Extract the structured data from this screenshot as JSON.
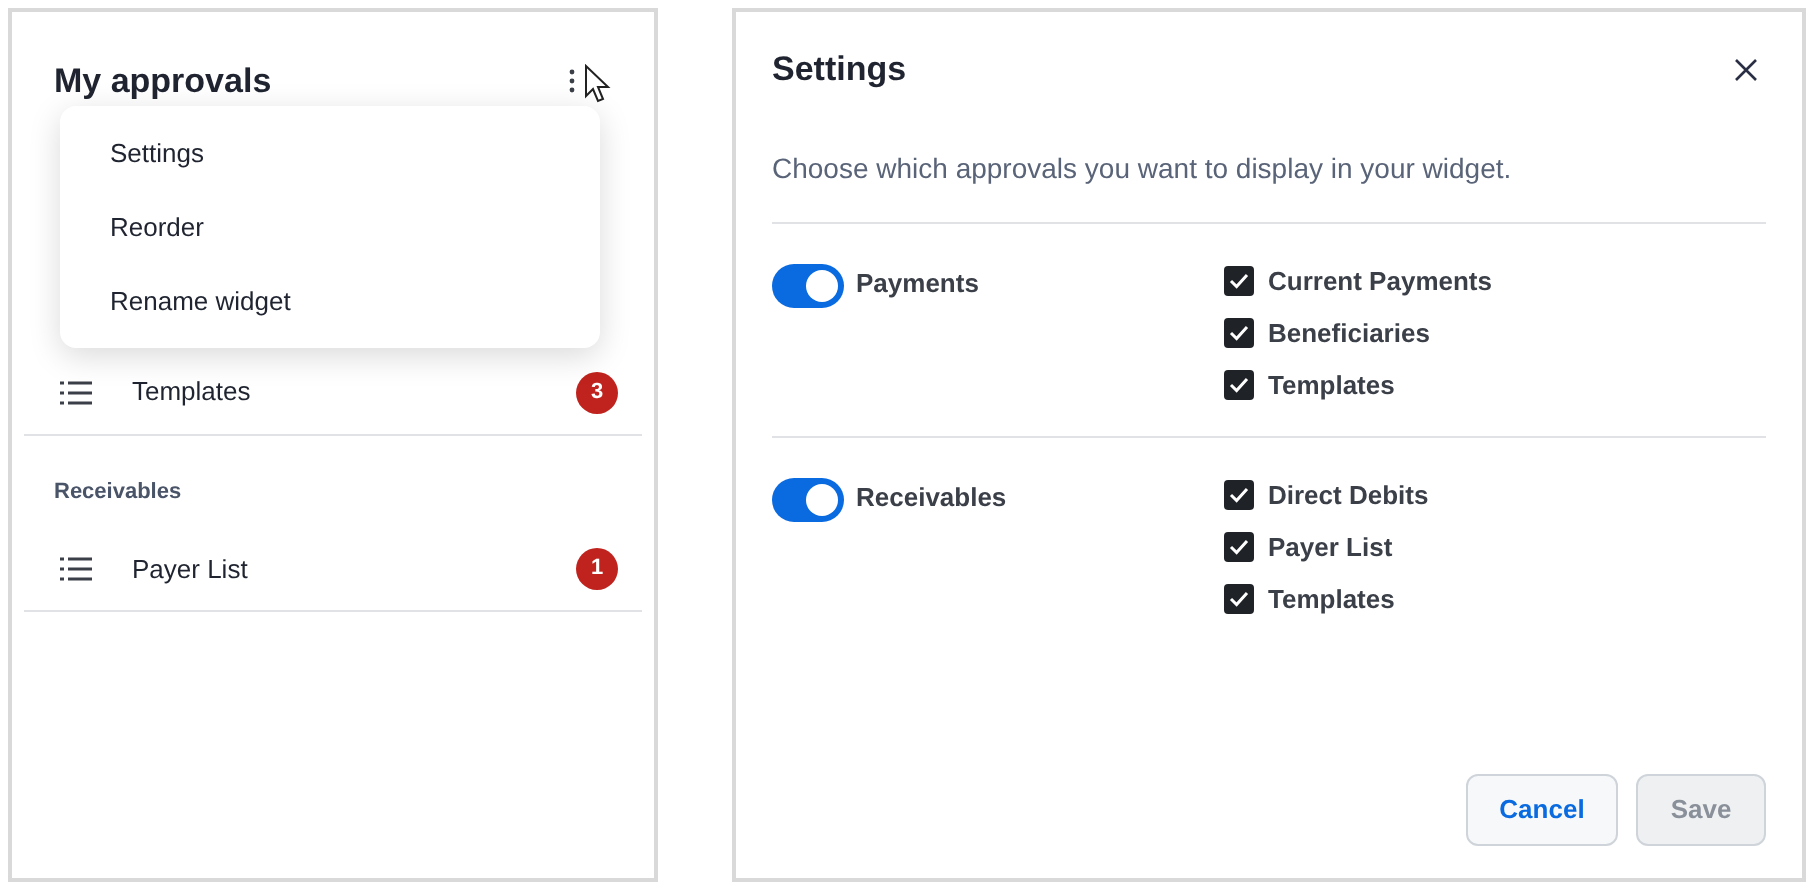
{
  "widget": {
    "title": "My approvals",
    "groups": [
      {
        "items": [
          {
            "label": "Templates",
            "count": "3"
          }
        ]
      },
      {
        "heading": "Receivables",
        "items": [
          {
            "label": "Payer List",
            "count": "1"
          }
        ]
      }
    ],
    "menu": [
      "Settings",
      "Reorder",
      "Rename widget"
    ]
  },
  "dialog": {
    "title": "Settings",
    "description": "Choose which approvals you want to display in your widget.",
    "sections": [
      {
        "label": "Payments",
        "on": true,
        "options": [
          {
            "label": "Current Payments",
            "checked": true
          },
          {
            "label": "Beneficiaries",
            "checked": true
          },
          {
            "label": "Templates",
            "checked": true
          }
        ]
      },
      {
        "label": "Receivables",
        "on": true,
        "options": [
          {
            "label": "Direct Debits",
            "checked": true
          },
          {
            "label": "Payer List",
            "checked": true
          },
          {
            "label": "Templates",
            "checked": true
          }
        ]
      }
    ],
    "buttons": [
      {
        "label": "Cancel",
        "disabled": false
      },
      {
        "label": "Save",
        "disabled": true
      }
    ]
  }
}
